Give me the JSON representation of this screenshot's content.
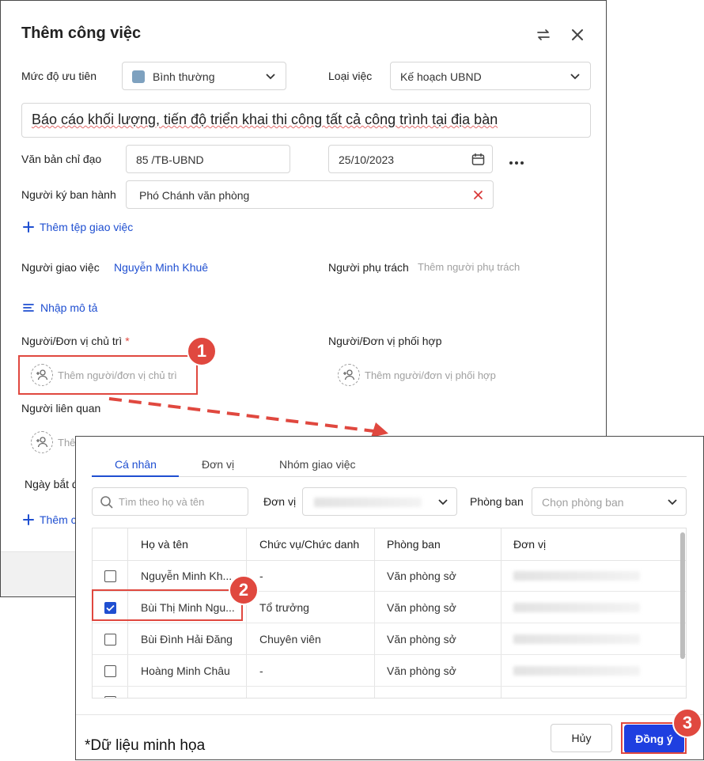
{
  "dialog": {
    "title": "Thêm công việc",
    "priority": {
      "label": "Mức độ ưu tiên",
      "value": "Bình thường",
      "color": "#7ea1bf"
    },
    "task_type": {
      "label": "Loại việc",
      "value": "Kế hoạch UBND"
    },
    "task_name": "Báo cáo khối lượng, tiến độ triển khai thi công tất cả công trình tại địa bàn",
    "directive_doc": {
      "label": "Văn bản chỉ đạo",
      "number": "85 /TB-UBND",
      "date": "25/10/2023"
    },
    "signer": {
      "label": "Người ký ban hành",
      "value": "Phó Chánh văn phòng"
    },
    "add_attachment": "Thêm tệp giao việc",
    "assigner": {
      "label": "Người giao việc",
      "value": "Nguyễn Minh Khuê"
    },
    "owner": {
      "label": "Người phụ trách",
      "placeholder": "Thêm người phụ trách"
    },
    "add_description": "Nhập mô tả",
    "lead": {
      "label": "Người/Đơn vị chủ trì",
      "required_mark": "*",
      "placeholder": "Thêm người/đơn vị chủ trì"
    },
    "cooperate": {
      "label": "Người/Đơn vị phối hợp",
      "placeholder": "Thêm người/đơn vị phối hợp"
    },
    "related": {
      "label": "Người liên quan",
      "placeholder_partial": "Thê"
    },
    "start_date_partial": "Ngày bắt đ",
    "add_partial": "Thêm c"
  },
  "picker": {
    "tabs": [
      "Cá nhân",
      "Đơn vị",
      "Nhóm giao việc"
    ],
    "active_tab": 0,
    "search_placeholder": "Tìm theo họ và tên",
    "unit_label": "Đơn vị",
    "dept_label": "Phòng ban",
    "dept_placeholder": "Chọn phòng ban",
    "columns": [
      "Họ và tên",
      "Chức vụ/Chức danh",
      "Phòng ban",
      "Đơn vị"
    ],
    "rows": [
      {
        "name": "Nguyễn Minh Kh...",
        "title": "-",
        "dept": "Văn phòng sở",
        "checked": false
      },
      {
        "name": "Bùi Thị Minh Ngu...",
        "title": "Tổ trưởng",
        "dept": "Văn phòng sở",
        "checked": true
      },
      {
        "name": "Bùi Đình Hải Đăng",
        "title": "Chuyên viên",
        "dept": "Văn phòng sở",
        "checked": false
      },
      {
        "name": "Hoàng Minh Châu",
        "title": "-",
        "dept": "Văn phòng sở",
        "checked": false
      }
    ],
    "cancel_label": "Hủy",
    "confirm_label": "Đồng ý",
    "note": "*Dữ liệu minh họa"
  },
  "callouts": [
    "1",
    "2",
    "3"
  ],
  "colors": {
    "accent": "#1f4fd1",
    "callout": "#e0483f",
    "primary_button": "#1f3fe0"
  }
}
